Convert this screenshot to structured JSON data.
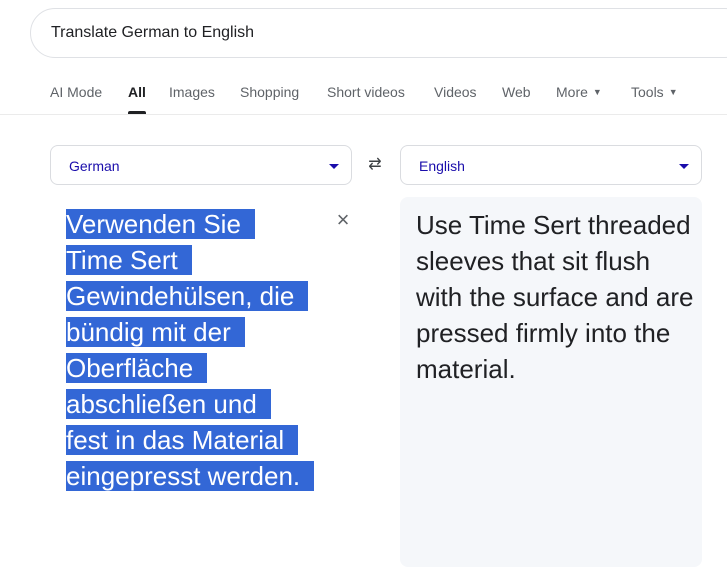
{
  "search": {
    "query": "Translate German to English",
    "close_icon": "×"
  },
  "tabs": [
    {
      "label": "AI Mode"
    },
    {
      "label": "All",
      "active": true
    },
    {
      "label": "Images"
    },
    {
      "label": "Shopping"
    },
    {
      "label": "Short videos"
    },
    {
      "label": "Videos"
    },
    {
      "label": "Web"
    },
    {
      "label": "More"
    },
    {
      "label": "Tools"
    }
  ],
  "translator": {
    "source_language": "German",
    "target_language": "English",
    "swap_icon": "⇄",
    "clear_icon": "×",
    "source_lines": [
      "Verwenden Sie",
      "Time Sert",
      "Gewindehülsen, die",
      "bündig mit der",
      "Oberfläche",
      "abschließen und",
      "fest in das Material",
      "eingepresst werden."
    ],
    "target_text": "Use Time Sert threaded sleeves that sit flush with the surface and are pressed firmly into the material."
  },
  "colors": {
    "selection": "#3367d6",
    "language_text": "#1a0dab",
    "target_background": "#f5f7fa"
  }
}
